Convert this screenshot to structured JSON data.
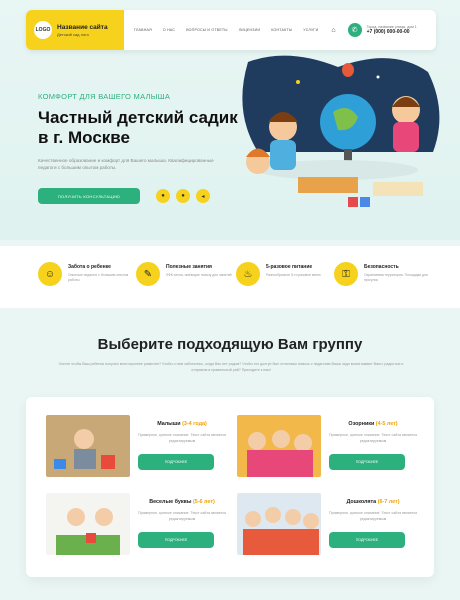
{
  "header": {
    "logo": "LOGO",
    "site_title": "Название сайта",
    "site_sub": "Детский сад лого",
    "nav": [
      "Главная",
      "О нас",
      "Вопросы и ответы",
      "Лицензии",
      "Контакты",
      "Услуги"
    ],
    "contact_caption": "Город, название улицы, дом 1",
    "phone": "+7 (000) 000-00-00"
  },
  "hero": {
    "tagline": "КОМФОРТ ДЛЯ ВАШЕГО МАЛЫША",
    "title": "Частный детский садик в г. Москве",
    "lead": "Качественное образование и комфорт для Вашего малыша. Квалифицированные педагоги с большим опытом работы.",
    "cta": "Получить консультацию"
  },
  "features": [
    {
      "title": "Забота о ребенке",
      "text": "Опытные педагоги с большим опытом работы",
      "icon": "child-care-icon"
    },
    {
      "title": "Полезные занятия",
      "text": "ЛФК сесна, имеющие пользу для занятий",
      "icon": "palette-icon"
    },
    {
      "title": "5-разовое питание",
      "text": "Разнообразное 5-ти разовое меню",
      "icon": "food-icon"
    },
    {
      "title": "Безопасность",
      "text": "Охраняемая территория. Площадки для прогулок",
      "icon": "lock-icon"
    }
  ],
  "groups_section": {
    "title": "Выберите подходящую Вам группу",
    "intro": "Хотите чтобы Ваш ребенок получил всестороннее развитие? Чтобы о нем заботились, когда Вас нет рядом? Чтобы это доступ был отличным помочь с педагогам Ваша чадо воспитывают Вам с радостью я отправлю в правильный рай? Приходите к нам!",
    "cards": [
      {
        "name": "Малыши",
        "age": "(3-4 года)",
        "text": "Примерное, краткое описание. Текст сайта является редактируемым",
        "button": "Подробнее"
      },
      {
        "name": "Озорники",
        "age": "(4-5 лет)",
        "text": "Примерное, краткое описание. Текст сайта является редактируемым",
        "button": "Подробнее"
      },
      {
        "name": "Веселые буквы",
        "age": "(5-6 лет)",
        "text": "Примерное, краткое описание. Текст сайта является редактируемым",
        "button": "Подробнее"
      },
      {
        "name": "Дошколята",
        "age": "(6-7 лет)",
        "text": "Примерное, краткое описание. Текст сайта является редактируемым",
        "button": "Подробнее"
      }
    ]
  },
  "colors": {
    "accent": "#2cb07d",
    "brand": "#f6d21c",
    "age": "#f0a000"
  }
}
